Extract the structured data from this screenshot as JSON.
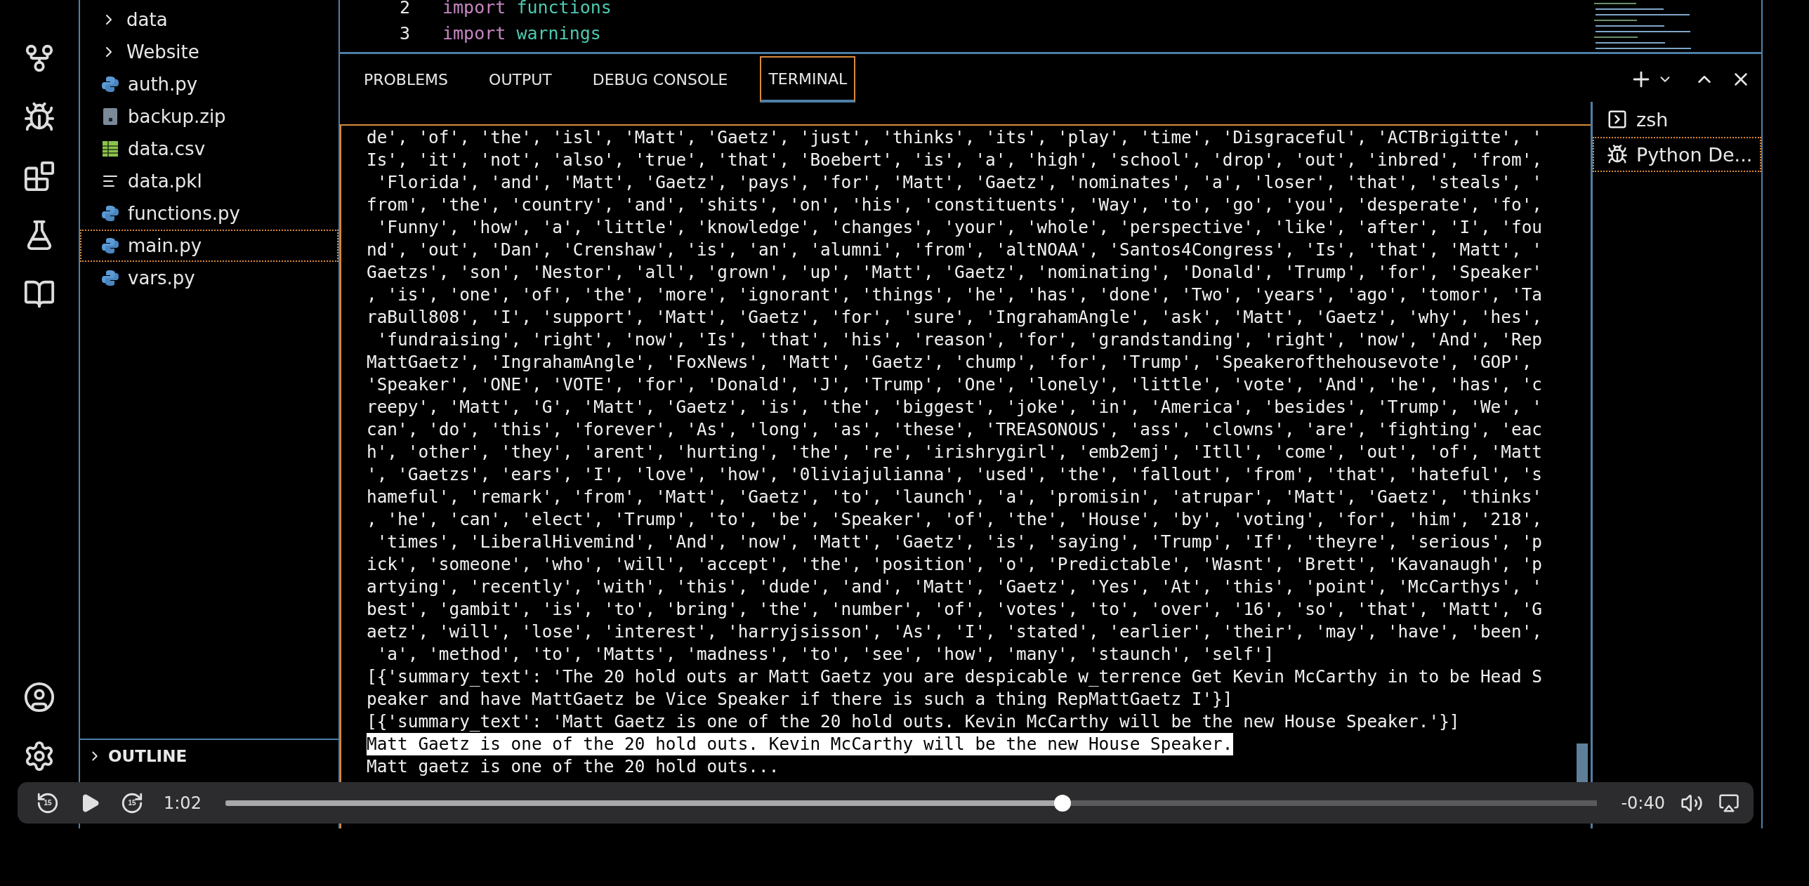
{
  "editor": {
    "lines": [
      {
        "number": "2",
        "keyword": "import",
        "module": "functions"
      },
      {
        "number": "3",
        "keyword": "import",
        "module": "warnings"
      }
    ]
  },
  "sidebar": {
    "items": [
      {
        "label": "data",
        "kind": "folder",
        "selected": false
      },
      {
        "label": "Website",
        "kind": "folder",
        "selected": false
      },
      {
        "label": "auth.py",
        "kind": "python",
        "selected": false
      },
      {
        "label": "backup.zip",
        "kind": "archive",
        "selected": false
      },
      {
        "label": "data.csv",
        "kind": "spreadsheet",
        "selected": false
      },
      {
        "label": "data.pkl",
        "kind": "text",
        "selected": false
      },
      {
        "label": "functions.py",
        "kind": "python",
        "selected": false
      },
      {
        "label": "main.py",
        "kind": "python",
        "selected": true
      },
      {
        "label": "vars.py",
        "kind": "python",
        "selected": false
      }
    ],
    "sections": [
      {
        "label": "OUTLINE",
        "expanded": false
      }
    ]
  },
  "panel": {
    "tabs": [
      {
        "label": "PROBLEMS",
        "selected": false
      },
      {
        "label": "OUTPUT",
        "selected": false
      },
      {
        "label": "DEBUG CONSOLE",
        "selected": false
      },
      {
        "label": "TERMINAL",
        "selected": true
      }
    ]
  },
  "terminal": {
    "lines": [
      {
        "text": "de', 'of', 'the', 'isl', 'Matt', 'Gaetz', 'just', 'thinks', 'its', 'play', 'time', 'Disgraceful', 'ACTBrigitte', '",
        "highlighted": false
      },
      {
        "text": "Is', 'it', 'not', 'also', 'true', 'that', 'Boebert', 'is', 'a', 'high', 'school', 'drop', 'out', 'inbred', 'from',",
        "highlighted": false
      },
      {
        "text": " 'Florida', 'and', 'Matt', 'Gaetz', 'pays', 'for', 'Matt', 'Gaetz', 'nominates', 'a', 'loser', 'that', 'steals', '",
        "highlighted": false
      },
      {
        "text": "from', 'the', 'country', 'and', 'shits', 'on', 'his', 'constituents', 'Way', 'to', 'go', 'you', 'desperate', 'fo',",
        "highlighted": false
      },
      {
        "text": " 'Funny', 'how', 'a', 'little', 'knowledge', 'changes', 'your', 'whole', 'perspective', 'like', 'after', 'I', 'fou",
        "highlighted": false
      },
      {
        "text": "nd', 'out', 'Dan', 'Crenshaw', 'is', 'an', 'alumni', 'from', 'altNOAA', 'Santos4Congress', 'Is', 'that', 'Matt', '",
        "highlighted": false
      },
      {
        "text": "Gaetzs', 'son', 'Nestor', 'all', 'grown', 'up', 'Matt', 'Gaetz', 'nominating', 'Donald', 'Trump', 'for', 'Speaker'",
        "highlighted": false
      },
      {
        "text": ", 'is', 'one', 'of', 'the', 'more', 'ignorant', 'things', 'he', 'has', 'done', 'Two', 'years', 'ago', 'tomor', 'Ta",
        "highlighted": false
      },
      {
        "text": "raBull808', 'I', 'support', 'Matt', 'Gaetz', 'for', 'sure', 'IngrahamAngle', 'ask', 'Matt', 'Gaetz', 'why', 'hes',",
        "highlighted": false
      },
      {
        "text": " 'fundraising', 'right', 'now', 'Is', 'that', 'his', 'reason', 'for', 'grandstanding', 'right', 'now', 'And', 'Rep",
        "highlighted": false
      },
      {
        "text": "MattGaetz', 'IngrahamAngle', 'FoxNews', 'Matt', 'Gaetz', 'chump', 'for', 'Trump', 'Speakerofthehousevote', 'GOP',",
        "highlighted": false
      },
      {
        "text": "'Speaker', 'ONE', 'VOTE', 'for', 'Donald', 'J', 'Trump', 'One', 'lonely', 'little', 'vote', 'And', 'he', 'has', 'c",
        "highlighted": false
      },
      {
        "text": "reepy', 'Matt', 'G', 'Matt', 'Gaetz', 'is', 'the', 'biggest', 'joke', 'in', 'America', 'besides', 'Trump', 'We', '",
        "highlighted": false
      },
      {
        "text": "can', 'do', 'this', 'forever', 'As', 'long', 'as', 'these', 'TREASONOUS', 'ass', 'clowns', 'are', 'fighting', 'eac",
        "highlighted": false
      },
      {
        "text": "h', 'other', 'they', 'arent', 'hurting', 'the', 're', 'irishrygirl', 'emb2emj', 'Itll', 'come', 'out', 'of', 'Matt",
        "highlighted": false
      },
      {
        "text": "', 'Gaetzs', 'ears', 'I', 'love', 'how', '0liviajulianna', 'used', 'the', 'fallout', 'from', 'that', 'hateful', 's",
        "highlighted": false
      },
      {
        "text": "hameful', 'remark', 'from', 'Matt', 'Gaetz', 'to', 'launch', 'a', 'promisin', 'atrupar', 'Matt', 'Gaetz', 'thinks'",
        "highlighted": false
      },
      {
        "text": ", 'he', 'can', 'elect', 'Trump', 'to', 'be', 'Speaker', 'of', 'the', 'House', 'by', 'voting', 'for', 'him', '218',",
        "highlighted": false
      },
      {
        "text": " 'times', 'LiberalHivemind', 'And', 'now', 'Matt', 'Gaetz', 'is', 'saying', 'Trump', 'If', 'theyre', 'serious', 'p",
        "highlighted": false
      },
      {
        "text": "ick', 'someone', 'who', 'will', 'accept', 'the', 'position', 'o', 'Predictable', 'Wasnt', 'Brett', 'Kavanaugh', 'p",
        "highlighted": false
      },
      {
        "text": "artying', 'recently', 'with', 'this', 'dude', 'and', 'Matt', 'Gaetz', 'Yes', 'At', 'this', 'point', 'McCarthys', '",
        "highlighted": false
      },
      {
        "text": "best', 'gambit', 'is', 'to', 'bring', 'the', 'number', 'of', 'votes', 'to', 'over', '16', 'so', 'that', 'Matt', 'G",
        "highlighted": false
      },
      {
        "text": "aetz', 'will', 'lose', 'interest', 'harryjsisson', 'As', 'I', 'stated', 'earlier', 'their', 'may', 'have', 'been',",
        "highlighted": false
      },
      {
        "text": " 'a', 'method', 'to', 'Matts', 'madness', 'to', 'see', 'how', 'many', 'staunch', 'self']",
        "highlighted": false
      },
      {
        "text": "[{'summary_text': 'The 20 hold outs ar Matt Gaetz you are despicable w_terrence Get Kevin McCarthy in to be Head S",
        "highlighted": false
      },
      {
        "text": "peaker and have MattGaetz be Vice Speaker if there is such a thing RepMattGaetz I'}]",
        "highlighted": false
      },
      {
        "text": "[{'summary_text': 'Matt Gaetz is one of the 20 hold outs. Kevin McCarthy will be the new House Speaker.'}]",
        "highlighted": false
      },
      {
        "text": "Matt Gaetz is one of the 20 hold outs. Kevin McCarthy will be the new House Speaker.",
        "highlighted": true
      },
      {
        "text": "Matt gaetz is one of the 20 hold outs...",
        "highlighted": false
      }
    ],
    "sessions": [
      {
        "label": "zsh",
        "kind": "shell",
        "selected": false
      },
      {
        "label": "Python De...",
        "kind": "debug",
        "selected": true
      }
    ]
  },
  "player": {
    "skip_back_label": "15",
    "skip_forward_label": "15",
    "elapsed": "1:02",
    "remaining": "-0:40",
    "level": 0.61
  }
}
